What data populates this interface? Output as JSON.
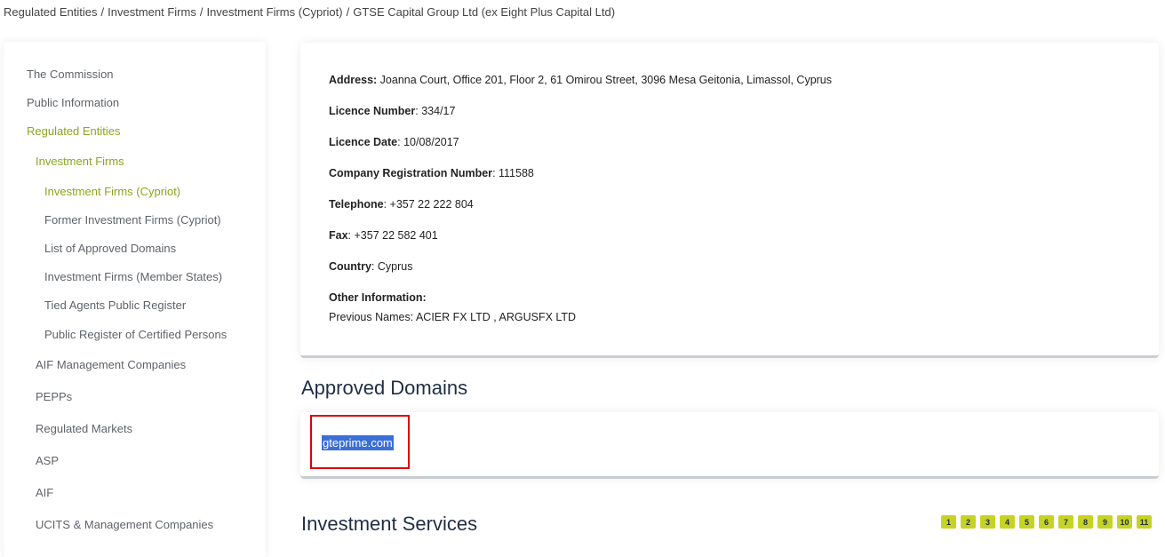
{
  "breadcrumb": {
    "items": [
      "Regulated Entities",
      "Investment Firms",
      "Investment Firms (Cypriot)",
      "GTSE Capital Group Ltd (ex Eight Plus Capital Ltd)"
    ],
    "separator": "/"
  },
  "sidebar": {
    "items": [
      {
        "label": "The Commission",
        "level": 0,
        "active": false
      },
      {
        "label": "Public Information",
        "level": 0,
        "active": false
      },
      {
        "label": "Regulated Entities",
        "level": 0,
        "active": true
      },
      {
        "label": "Investment Firms",
        "level": 1,
        "active": true
      },
      {
        "label": "Investment Firms (Cypriot)",
        "level": 2,
        "active": true
      },
      {
        "label": "Former Investment Firms (Cypriot)",
        "level": 2,
        "active": false
      },
      {
        "label": "List of Approved Domains",
        "level": 2,
        "active": false
      },
      {
        "label": "Investment Firms (Member States)",
        "level": 2,
        "active": false
      },
      {
        "label": "Tied Agents Public Register",
        "level": 2,
        "active": false
      },
      {
        "label": "Public Register of Certified Persons",
        "level": 2,
        "active": false
      },
      {
        "label": "AIF Management Companies",
        "level": 1,
        "active": false
      },
      {
        "label": "PEPPs",
        "level": 1,
        "active": false
      },
      {
        "label": "Regulated Markets",
        "level": 1,
        "active": false
      },
      {
        "label": "ASP",
        "level": 1,
        "active": false
      },
      {
        "label": "AIF",
        "level": 1,
        "active": false
      },
      {
        "label": "UCITS & Management Companies",
        "level": 1,
        "active": false
      }
    ]
  },
  "details": {
    "address_label": "Address:",
    "address_value": " Joanna Court, Office 201, Floor 2, 61 Omirou Street, 3096 Mesa Geitonia, Limassol, Cyprus",
    "licence_number_label": "Licence Number",
    "licence_number_value": ": 334/17",
    "licence_date_label": "Licence Date",
    "licence_date_value": ": 10/08/2017",
    "registration_label": "Company Registration Number",
    "registration_value": ": 111588",
    "telephone_label": "Telephone",
    "telephone_value": ": +357 22 222 804",
    "fax_label": "Fax",
    "fax_value": ": +357 22 582 401",
    "country_label": "Country",
    "country_value": ": Cyprus",
    "other_info_label": "Other Information:",
    "previous_names": "Previous Names: ACIER FX LTD , ARGUSFX LTD"
  },
  "approved_domains": {
    "title": "Approved Domains",
    "domains": [
      "gteprime.com"
    ]
  },
  "investment_services": {
    "title": "Investment Services",
    "pages": [
      "1",
      "2",
      "3",
      "4",
      "5",
      "6",
      "7",
      "8",
      "9",
      "10",
      "11"
    ]
  },
  "colors": {
    "accent_green": "#8aa61e",
    "pager_green": "#c6d324",
    "heading_navy": "#1f2e45",
    "selection_blue": "#3b6fd6",
    "highlight_red": "#e00000"
  }
}
